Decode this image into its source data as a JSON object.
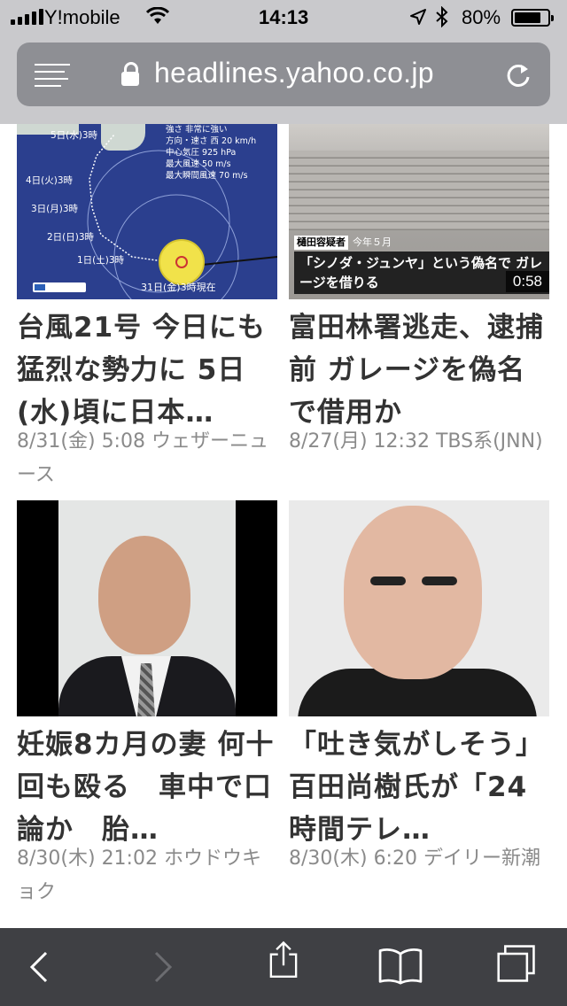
{
  "status_bar": {
    "carrier": "Y!mobile",
    "time": "14:13",
    "battery": "80%",
    "battery_level": 0.8
  },
  "browser": {
    "url": "headlines.yahoo.co.jp"
  },
  "articles": [
    {
      "title": "台風21号 今日にも猛烈な勢力に 5日(水)頃に日本…",
      "meta": "8/31(金) 5:08 ウェザーニュース",
      "thumb": {
        "legend": [
          "強さ 非常に強い",
          "方向・速さ 西 20 km/h",
          "中心気圧 925 hPa",
          "最大風速 50 m/s",
          "最大瞬間風速 70 m/s"
        ],
        "labels": [
          "5日(水)3時",
          "4日(火)3時",
          "3日(月)3時",
          "2日(日)3時",
          "1日(土)3時"
        ],
        "stamp": "31日(金)3時現在"
      }
    },
    {
      "title": "富田林署逃走、逮捕前 ガレージを偽名で借用か",
      "meta": "8/27(月) 12:32 TBS系(JNN)",
      "thumb": {
        "tag": "樋田容疑者",
        "tag_note": "今年５月",
        "caption": "「シノダ・ジュンヤ」という偽名で ガレージを借りる",
        "duration": "0:58"
      }
    },
    {
      "title": "妊娠8カ月の妻 何十回も殴る　車中で口論か　胎…",
      "meta": "8/30(木) 21:02 ホウドウキョク"
    },
    {
      "title": "「吐き気がしそう」　百田尚樹氏が「24時間テレ…",
      "meta": "8/30(木) 6:20 デイリー新潮"
    }
  ],
  "icons": {
    "menu": "hamburger-icon",
    "lock": "lock-icon",
    "reload": "reload-icon",
    "back": "back-icon",
    "forward": "forward-icon",
    "share": "share-icon",
    "bookmarks": "bookmarks-icon",
    "tabs": "tabs-icon"
  }
}
